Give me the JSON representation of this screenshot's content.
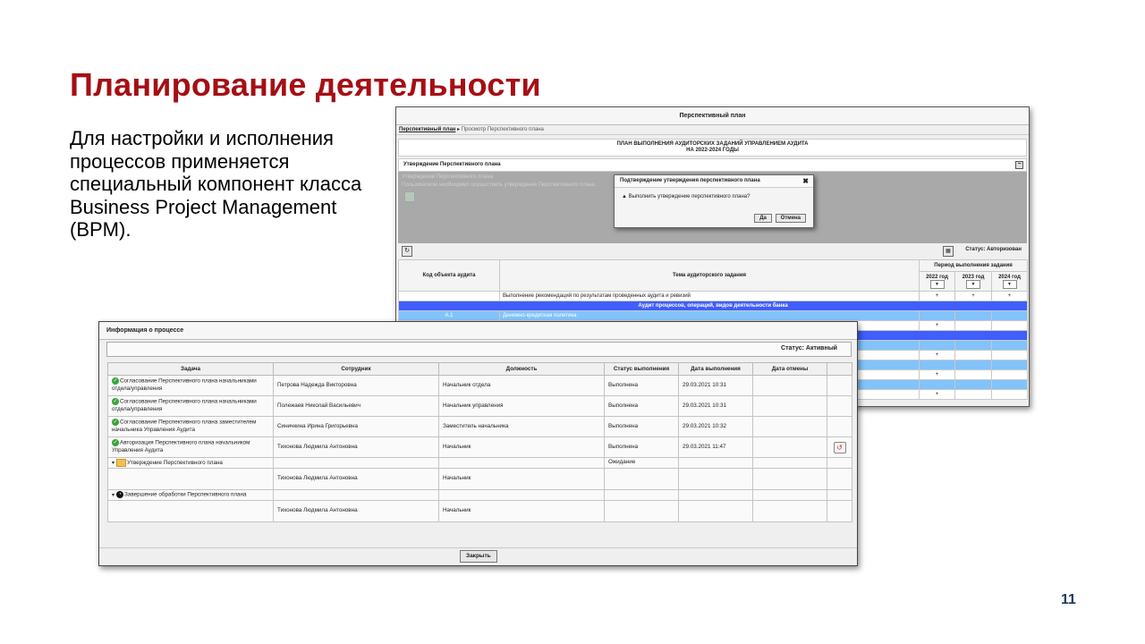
{
  "slide": {
    "title": "Планирование деятельности",
    "lead": "Для настройки и исполнения процессов применяется специальный компонент класса Business Project Management (BPM).",
    "page_number": "11"
  },
  "plan_window": {
    "title": "Перспективный план",
    "breadcrumb_link": "Перспективный план",
    "breadcrumb_sep": "▸",
    "breadcrumb_current": "Просмотр Перспективного плана",
    "plan_line1": "ПЛАН ВЫПОЛНЕНИЯ АУДИТОРСКИХ ЗАДАНИЙ УПРАВЛЕНИЕМ АУДИТА",
    "plan_line2": "НА 2022-2024 ГОДЫ",
    "approval_header": "Утверждение Перспективного плана",
    "approval_collapse": "−",
    "overlay_line1": "Утверждение Перспективного плана",
    "overlay_line2": "Пользователю необходимо осуществить утверждение Перспективного плана.",
    "dialog_title": "Подтверждение утверждения перспективного плана",
    "dialog_close": "✖",
    "dialog_warn": "▲",
    "dialog_text": "Выполнить утверждение перспективного плана?",
    "dialog_yes": "Да",
    "dialog_cancel": "Отмена",
    "refresh_glyph": "↻",
    "grid_glyph": "▦",
    "status": "Статус: Авторизован",
    "col_code": "Код объекта аудита",
    "col_topic": "Тема аудиторского задания",
    "col_period": "Период выполнения задания",
    "years": [
      "2022 год",
      "2023 год",
      "2024 год"
    ],
    "dropdown_glyph": "▼",
    "row_recommendations": "Выполнение рекомендаций по результатам проведенных аудита и ревизий",
    "plus": "+",
    "section_blue": "Аудит процессов, операций, видов деятельности банка",
    "row_a1_code": "А.1",
    "row_a1_topic": "Денежно-кредитная политика"
  },
  "process_window": {
    "title": "Информация о процессе",
    "status": "Статус: Активный",
    "columns": [
      "Задача",
      "Сотрудник",
      "Должность",
      "Статус выполнения",
      "Дата выполнения",
      "Дата отмены"
    ],
    "icon_ok": "✓",
    "icon_clock": "◔",
    "icon_undo": "↺",
    "icon_expand": "▾",
    "rows": [
      {
        "task": "Согласование Перспективного плана начальниками отдела/управления",
        "employee": "Петрова Надежда Викторовна",
        "position": "Начальник отдела",
        "status": "Выполнена",
        "date": "29.03.2021 10:31"
      },
      {
        "task": "Согласование Перспективного плана начальниками отдела/управления",
        "employee": "Полежаев Николай Васильевич",
        "position": "Начальник управления",
        "status": "Выполнена",
        "date": "29.03.2021 10:31"
      },
      {
        "task": "Согласование Перспективного плана заместителем начальника Управления Аудита",
        "employee": "Синичкина Ирина Григорьевна",
        "position": "Заместитель начальника",
        "status": "Выполнена",
        "date": "29.03.2021 10:32"
      },
      {
        "task": "Авторизация Перспективного плана начальником Управления Аудита",
        "employee": "Тихонова Людмила Антоновна",
        "position": "Начальник",
        "status": "Выполнена",
        "date": "29.03.2021 11:47"
      }
    ],
    "group_approval": {
      "task": "Утверждение Перспективного плана",
      "status": "Ожидание",
      "employee": "Тихонова Людмила Антоновна",
      "position": "Начальник"
    },
    "group_finish": {
      "task": "Завершение обработки Перспективного плана",
      "employee": "Тихонова Людмила Антоновна",
      "position": "Начальник"
    },
    "close_label": "Закрыть"
  }
}
